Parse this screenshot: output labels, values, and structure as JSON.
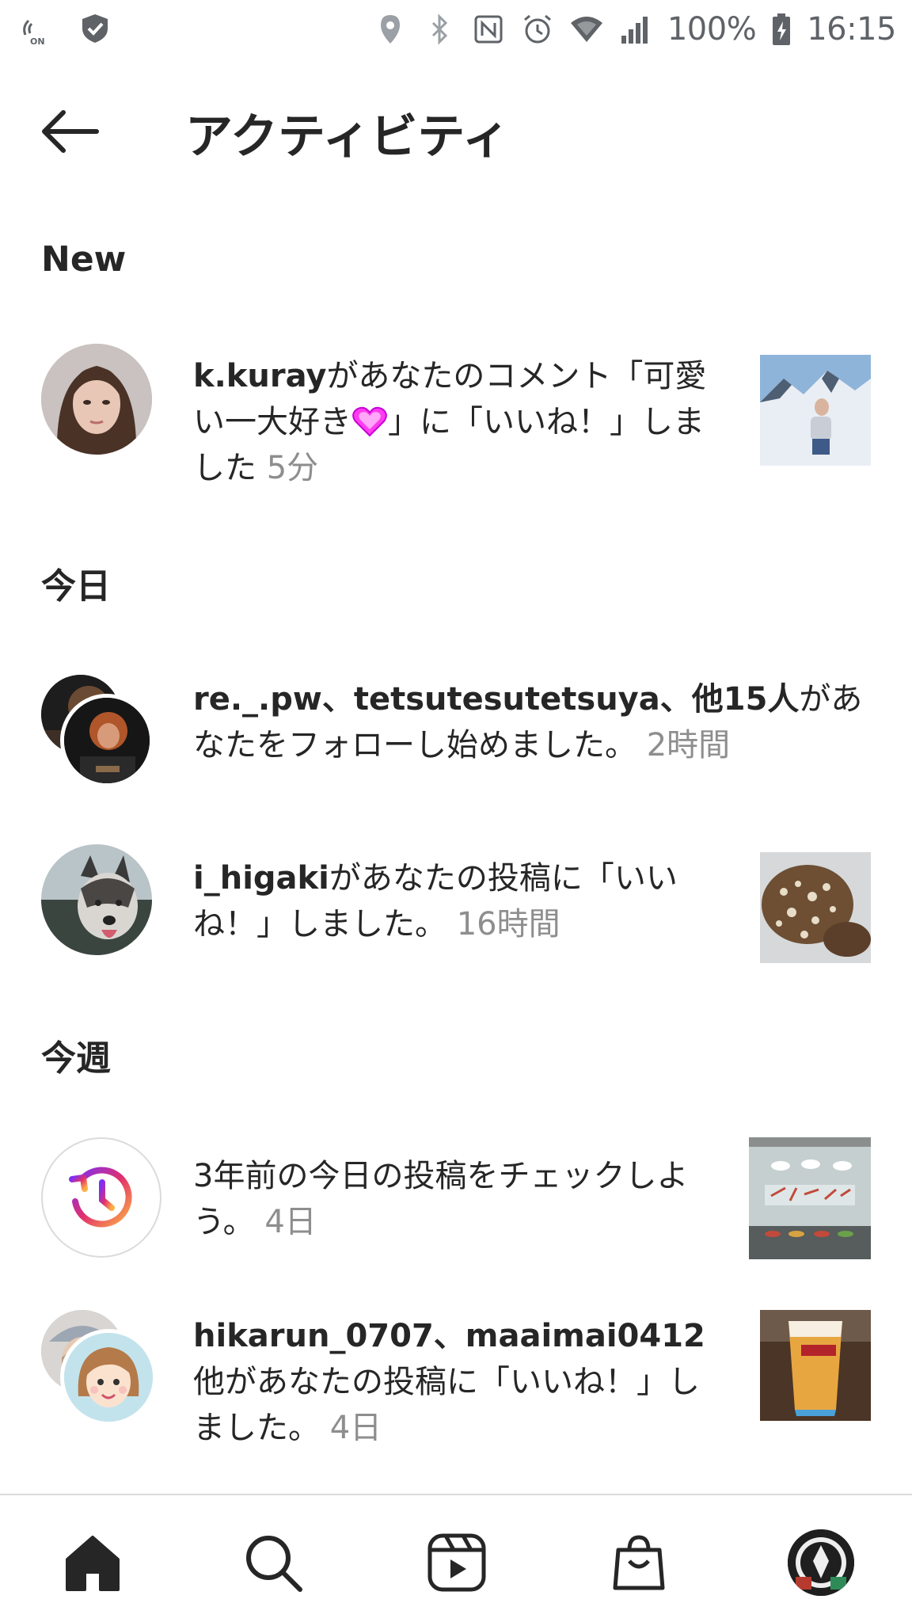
{
  "status_bar": {
    "battery": "100%",
    "time": "16:15",
    "icons": [
      "nfc-on-icon",
      "shield-check-icon",
      "location-icon",
      "bluetooth-icon",
      "nfc-icon",
      "alarm-icon",
      "wifi-icon",
      "signal-icon",
      "battery-icon"
    ]
  },
  "header": {
    "title": "アクティビティ",
    "back_icon": "arrow-left-icon"
  },
  "sections": {
    "new": "New",
    "today": "今日",
    "this_week": "今週"
  },
  "activities": [
    {
      "user": "k.kuray",
      "text": "があなたのコメント「可愛い一大好き",
      "text_after_heart": "」に「いいね！」しました",
      "time": "5分"
    },
    {
      "user": "re._.pw、tetsutesutetsuya、他15人",
      "text": "があなたをフォローし始めました。",
      "time": "2時間"
    },
    {
      "user": "i_higaki",
      "text": "があなたの投稿に「いいね！」しました。",
      "time": "16時間"
    },
    {
      "user": "",
      "text": "3年前の今日の投稿をチェックしよう。",
      "time": "4日"
    },
    {
      "user": "hikarun_0707、maaimai0412",
      "text": "他があなたの投稿に「いいね！」しました。",
      "time": "4日"
    }
  ],
  "bottom_nav": {
    "items": [
      "home-icon",
      "search-icon",
      "reels-icon",
      "shop-icon",
      "profile-avatar"
    ]
  },
  "colors": {
    "text": "#262626",
    "secondary": "#8e8e8e",
    "heart": "#e91eff",
    "divider": "#dbdbdb"
  }
}
